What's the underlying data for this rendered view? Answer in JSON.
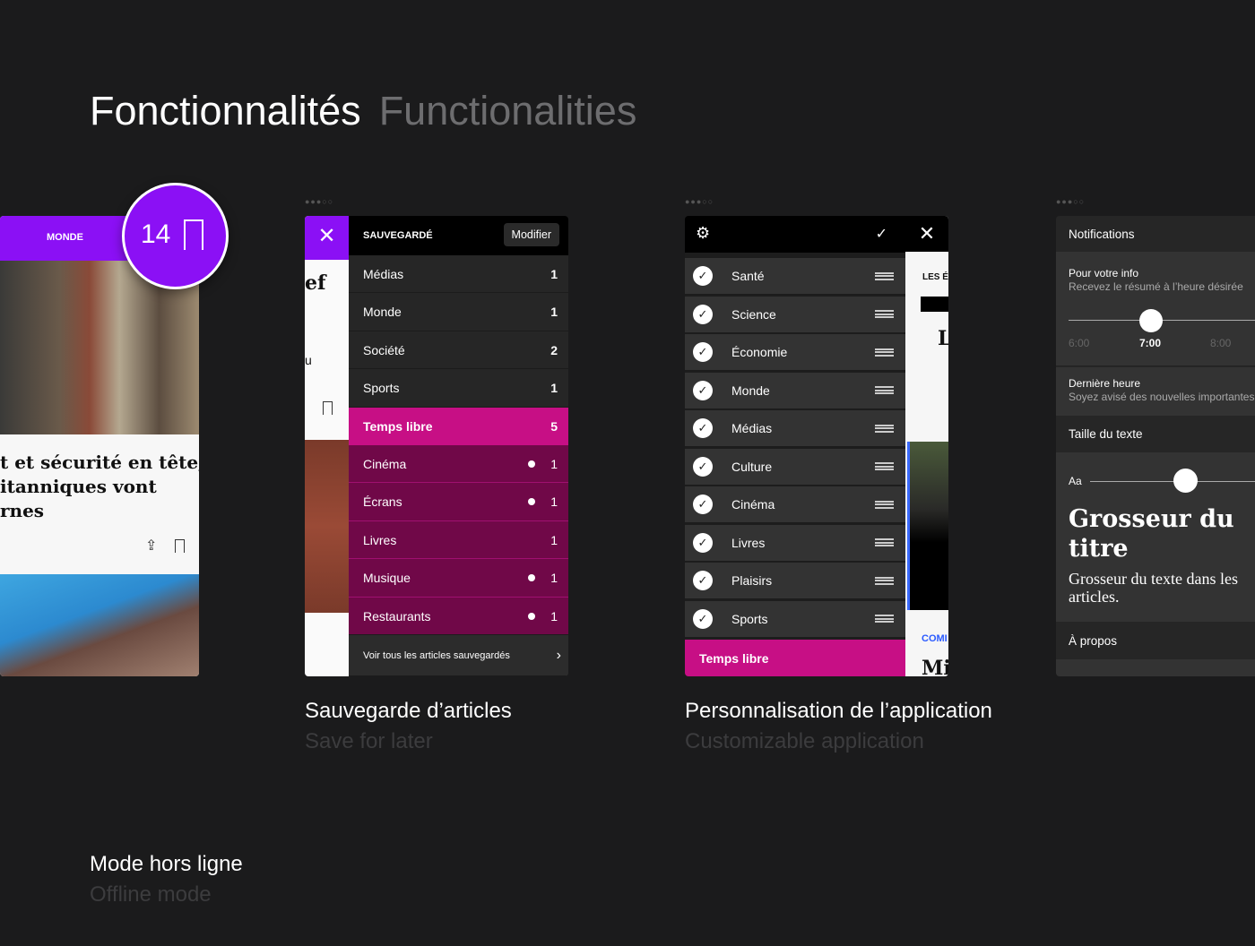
{
  "header": {
    "title_fr": "Fonctionnalités",
    "title_en": "Functionalities"
  },
  "colors": {
    "purple": "#8b10f5",
    "magenta": "#c70f85",
    "dark_magenta": "#700848",
    "background": "#1b1b1c"
  },
  "phone1": {
    "section": "MONDE",
    "badge_count": "14",
    "headline": [
      "t et sécurité en tête,",
      "itanniques vont",
      "rnes"
    ],
    "caption_fr": "Mode hors ligne",
    "caption_en": "Offline mode"
  },
  "phone2": {
    "panel_title": "SAUVEGARDÉ",
    "edit_button": "Modifier",
    "left_peek": [
      "ef",
      "u"
    ],
    "items": [
      {
        "label": "Médias",
        "count": "1"
      },
      {
        "label": "Monde",
        "count": "1"
      },
      {
        "label": "Société",
        "count": "2"
      },
      {
        "label": "Sports",
        "count": "1"
      }
    ],
    "highlight": {
      "label": "Temps libre",
      "count": "5"
    },
    "subitems": [
      {
        "label": "Cinéma",
        "count": "1",
        "new": true
      },
      {
        "label": "Écrans",
        "count": "1",
        "new": true
      },
      {
        "label": "Livres",
        "count": "1",
        "new": false
      },
      {
        "label": "Musique",
        "count": "1",
        "new": true
      },
      {
        "label": "Restaurants",
        "count": "1",
        "new": true
      }
    ],
    "footer_link": "Voir tous les articles sauvegardés",
    "caption_fr": "Sauvegarde d’articles",
    "caption_en": "Save for later"
  },
  "phone3": {
    "items": [
      "Santé",
      "Science",
      "Économie",
      "Monde",
      "Médias",
      "Culture",
      "Cinéma",
      "Livres",
      "Plaisirs",
      "Sports"
    ],
    "highlight": "Temps libre",
    "peek_label": "LES É",
    "peek_title": "L",
    "peek_section": "COMI",
    "peek_headline": "Mi",
    "caption_fr": "Personnalisation de l’application",
    "caption_en": "Customizable application"
  },
  "phone4": {
    "notifications": "Notifications",
    "fyi_title": "Pour votre info",
    "fyi_sub": "Recevez le résumé à l’heure désirée",
    "times": [
      "6:00",
      "7:00",
      "8:00"
    ],
    "time_selected": "7:00",
    "breaking_title": "Dernière heure",
    "breaking_sub": "Soyez avisé des nouvelles importantes",
    "text_size": "Taille du texte",
    "aa": "Aa",
    "text_size_level": 0.45,
    "preview_title": "Grosseur du titre",
    "preview_body": "Grosseur du texte dans les articles.",
    "about": "À propos"
  }
}
